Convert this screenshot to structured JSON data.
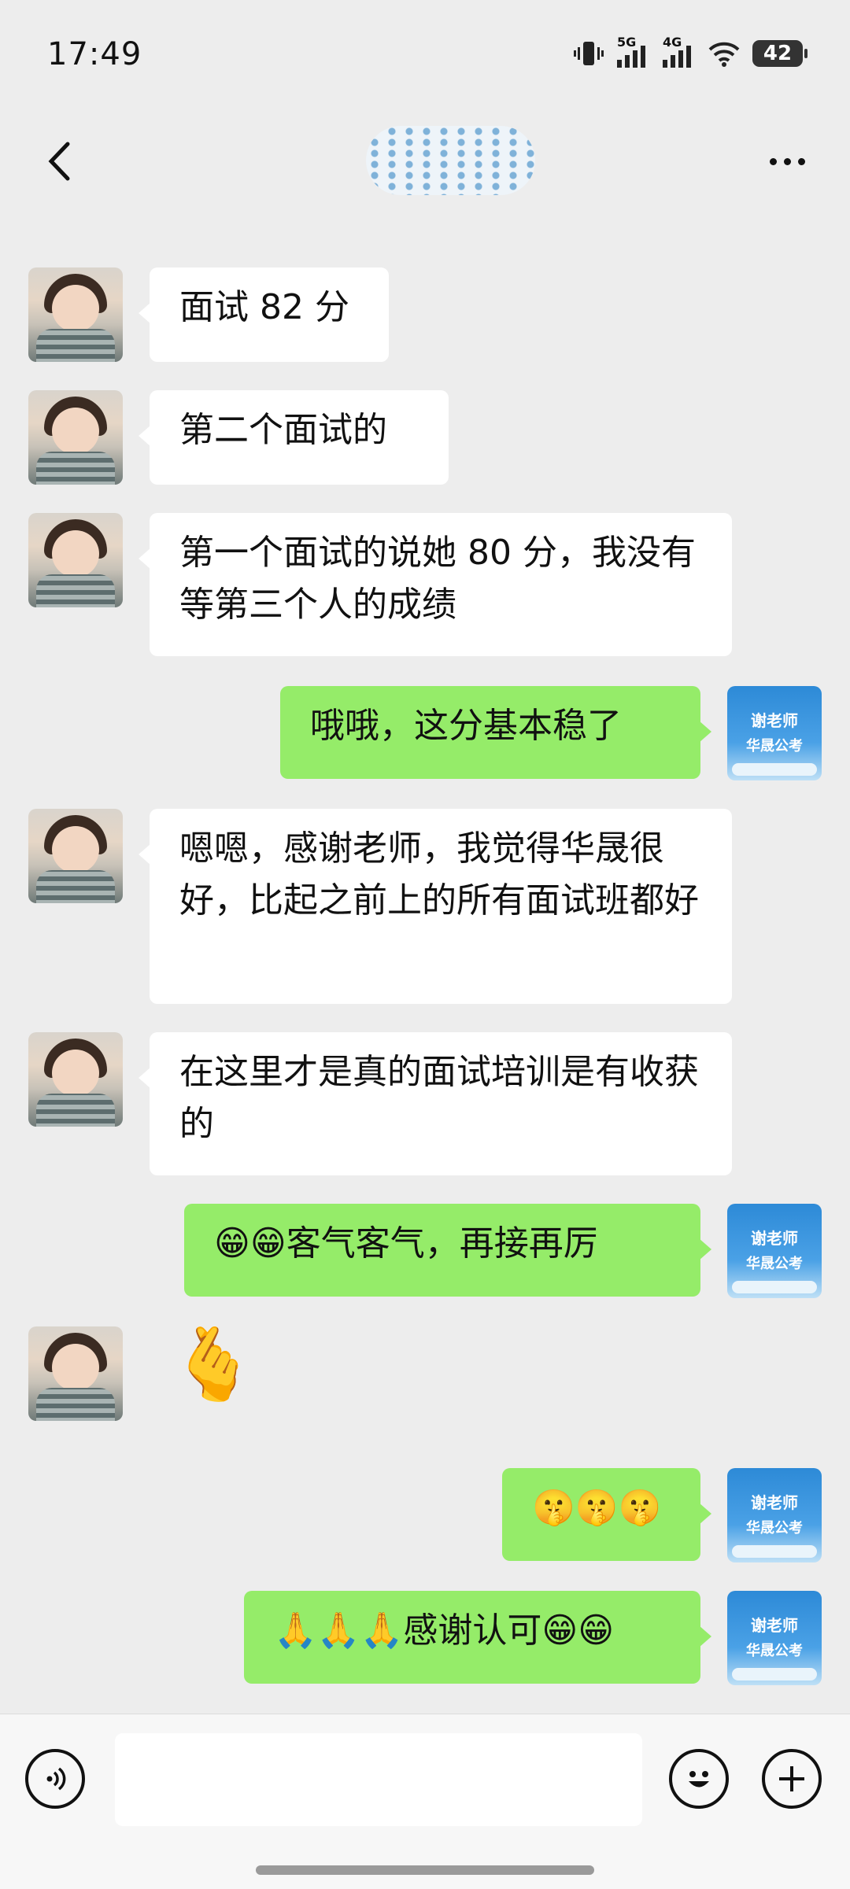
{
  "status_bar": {
    "time": "17:49",
    "signal_1": "5G",
    "signal_2": "4G",
    "battery": "42"
  },
  "header": {
    "back_icon": "chevron-left-icon",
    "more_icon": "more-dots-icon"
  },
  "messages": [
    {
      "side": "in",
      "text": "面试 82 分"
    },
    {
      "side": "in",
      "text": "第二个面试的"
    },
    {
      "side": "in",
      "text": "第一个面试的说她 80 分，我没有等第三个人的成绩"
    },
    {
      "side": "out",
      "text": "哦哦，这分基本稳了"
    },
    {
      "side": "in",
      "text": "嗯嗯，感谢老师，我觉得华晟很好，比起之前上的所有面试班都好"
    },
    {
      "side": "in",
      "text": "在这里才是真的面试培训是有收获的"
    },
    {
      "side": "out",
      "text": "😁😁客气客气，再接再厉"
    },
    {
      "side": "in",
      "sticker": "🫰"
    },
    {
      "side": "out",
      "text": "🤫🤫🤫"
    },
    {
      "side": "out",
      "text": "🙏🙏🙏感谢认可😁😁"
    }
  ],
  "right_avatar": {
    "line1": "谢老师",
    "line2": "华晟公考"
  },
  "input_bar": {
    "value": "",
    "voice_icon": "voice-icon",
    "emoji_icon": "emoji-icon",
    "plus_icon": "plus-icon"
  },
  "colors": {
    "background": "#ededed",
    "outgoing_bubble": "#95ec69",
    "incoming_bubble": "#ffffff"
  }
}
